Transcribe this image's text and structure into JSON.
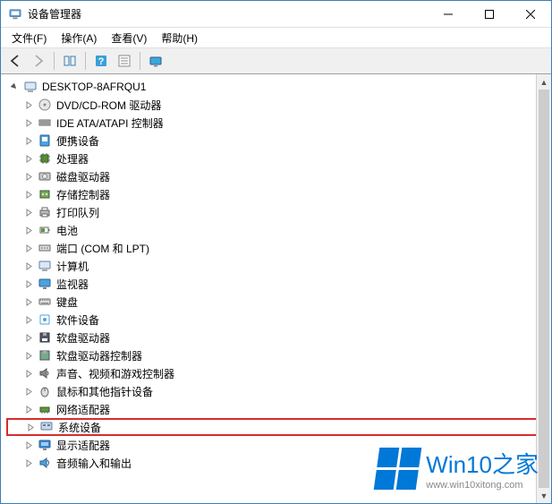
{
  "window": {
    "title": "设备管理器"
  },
  "menubar": {
    "file": "文件(F)",
    "action": "操作(A)",
    "view": "查看(V)",
    "help": "帮助(H)"
  },
  "tree": {
    "root": "DESKTOP-8AFRQU1",
    "items": [
      {
        "icon": "disc",
        "label": "DVD/CD-ROM 驱动器"
      },
      {
        "icon": "ide",
        "label": "IDE ATA/ATAPI 控制器"
      },
      {
        "icon": "portable",
        "label": "便携设备"
      },
      {
        "icon": "cpu",
        "label": "处理器"
      },
      {
        "icon": "disk",
        "label": "磁盘驱动器"
      },
      {
        "icon": "storage",
        "label": "存储控制器"
      },
      {
        "icon": "printer",
        "label": "打印队列"
      },
      {
        "icon": "battery",
        "label": "电池"
      },
      {
        "icon": "port",
        "label": "端口 (COM 和 LPT)"
      },
      {
        "icon": "computer",
        "label": "计算机"
      },
      {
        "icon": "monitor",
        "label": "监视器"
      },
      {
        "icon": "keyboard",
        "label": "键盘"
      },
      {
        "icon": "software",
        "label": "软件设备"
      },
      {
        "icon": "floppy",
        "label": "软盘驱动器"
      },
      {
        "icon": "floppyctrl",
        "label": "软盘驱动器控制器"
      },
      {
        "icon": "sound",
        "label": "声音、视频和游戏控制器"
      },
      {
        "icon": "mouse",
        "label": "鼠标和其他指针设备"
      },
      {
        "icon": "network",
        "label": "网络适配器"
      },
      {
        "icon": "system",
        "label": "系统设备",
        "highlighted": true
      },
      {
        "icon": "display",
        "label": "显示适配器"
      },
      {
        "icon": "audio",
        "label": "音频输入和输出"
      }
    ]
  },
  "watermark": {
    "title_prefix": "Win10",
    "title_suffix": "之家",
    "url": "www.win10xitong.com"
  }
}
